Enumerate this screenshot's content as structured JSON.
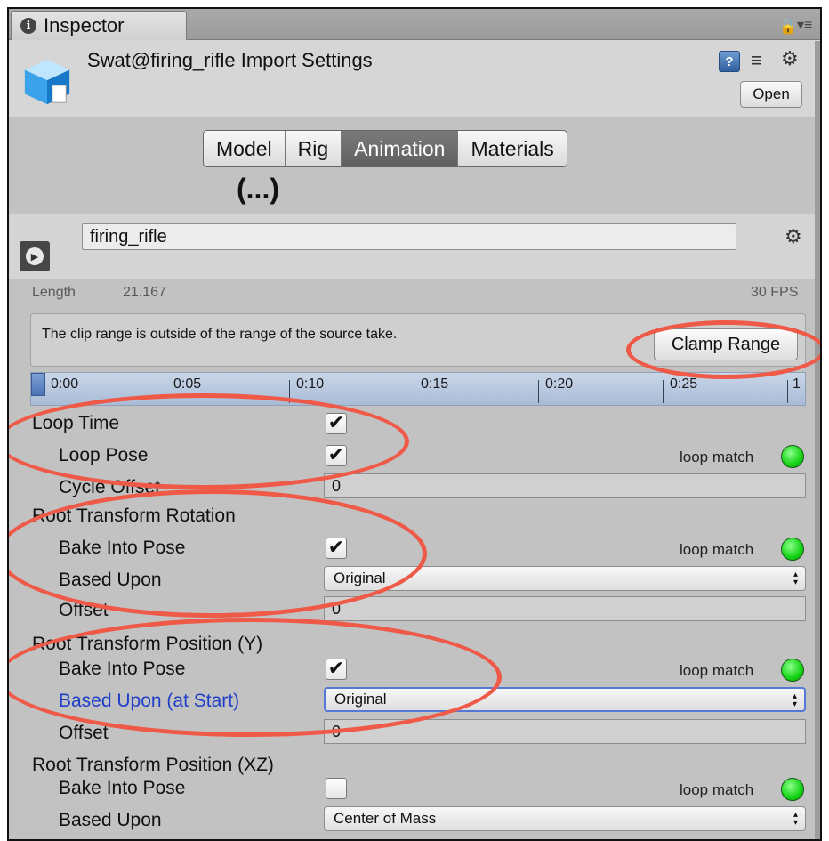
{
  "tab": {
    "label": "Inspector"
  },
  "header": {
    "title": "Swat@firing_rifle Import Settings",
    "open_label": "Open",
    "help_glyph": "?"
  },
  "tabs": [
    "Model",
    "Rig",
    "Animation",
    "Materials"
  ],
  "active_tab": "Animation",
  "ellipsis": "(...)",
  "clip": {
    "name": "firing_rifle",
    "length_label": "Length",
    "length_value": "21.167",
    "fps": "30 FPS"
  },
  "warning": {
    "text": "The clip range is outside of the range of the source take.",
    "button": "Clamp Range"
  },
  "timeline": {
    "ticks": [
      "0:00",
      "0:05",
      "0:10",
      "0:15",
      "0:20",
      "0:25",
      "1"
    ]
  },
  "rows": {
    "loop_time": "Loop Time",
    "loop_pose": "Loop Pose",
    "cycle_offset": "Cycle Offset",
    "cycle_offset_value": "0",
    "rot_section": "Root Transform Rotation",
    "rot_bake": "Bake Into Pose",
    "rot_based": "Based Upon",
    "rot_based_value": "Original",
    "rot_offset": "Offset",
    "rot_offset_value": "0",
    "posy_section": "Root Transform Position (Y)",
    "posy_bake": "Bake Into Pose",
    "posy_based": "Based Upon (at Start)",
    "posy_based_value": "Original",
    "posy_offset": "Offset",
    "posy_offset_value": "0",
    "posxz_section": "Root Transform Position (XZ)",
    "posxz_bake": "Bake Into Pose",
    "posxz_based": "Based Upon",
    "posxz_based_value": "Center of Mass",
    "loop_match": "loop match"
  },
  "checks": {
    "loop_time": true,
    "loop_pose": true,
    "rot_bake": true,
    "posy_bake": true,
    "posxz_bake": false
  },
  "colors": {
    "annotation": "#ef5a48",
    "lamp": "#13d313",
    "active_tab": "#666666"
  }
}
